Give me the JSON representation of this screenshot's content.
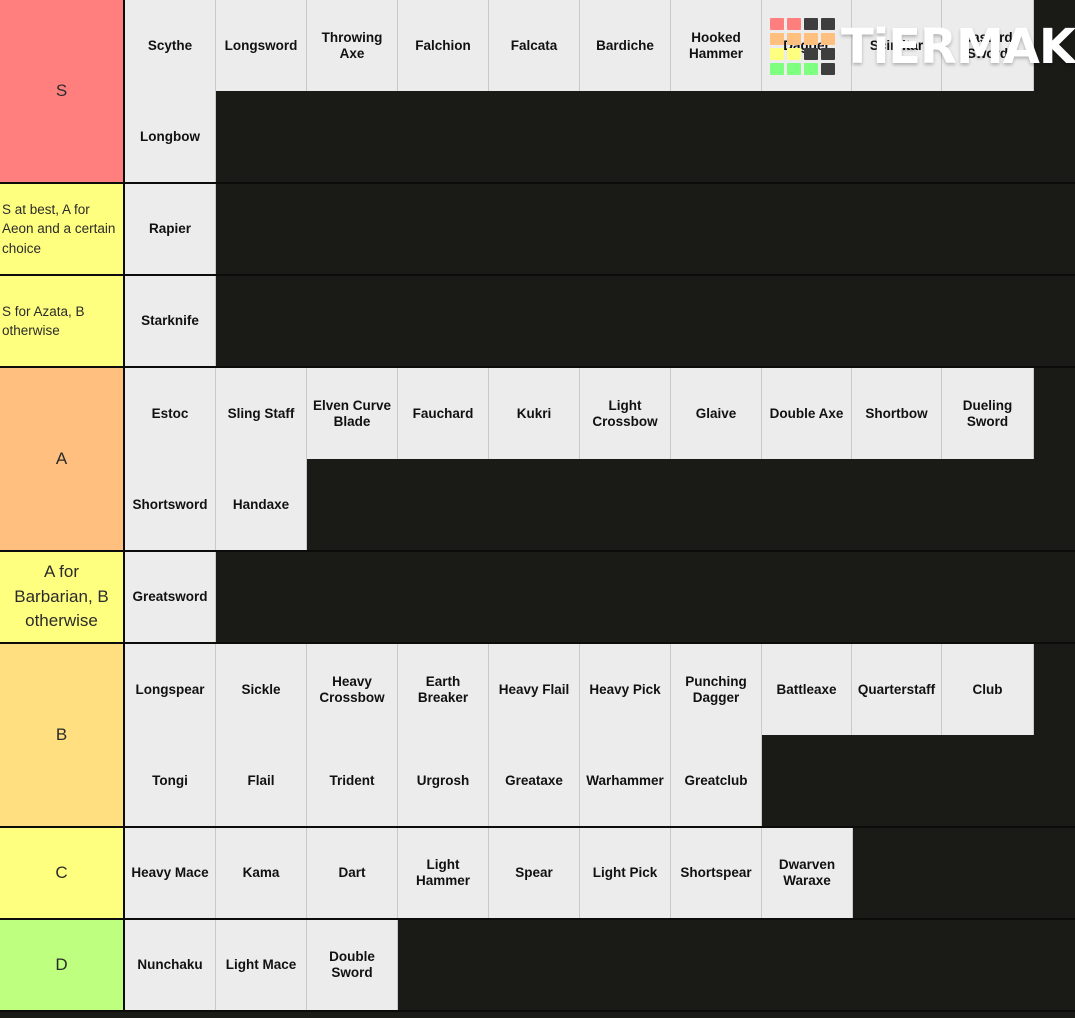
{
  "watermark": {
    "text": "TiERMAKER",
    "grid_colors": [
      "#ff7f7f",
      "#ff7f7f",
      "#3e3e3e",
      "#3e3e3e",
      "#ffbf7f",
      "#ffbf7f",
      "#ffbf7f",
      "#ffbf7f",
      "#ffff7f",
      "#ffff7f",
      "#3e3e3e",
      "#3e3e3e",
      "#7fff7f",
      "#7fff7f",
      "#7fff7f",
      "#3e3e3e"
    ]
  },
  "colors": {
    "tier_s": "#ff7f7f",
    "tier_note_yellow": "#ffff7f",
    "tier_a": "#ffbf7f",
    "tier_b": "#ffdf7f",
    "tier_c": "#ffff7f",
    "tier_d": "#bfff7f",
    "background": "#1a1a17",
    "item_background": "#ececec"
  },
  "tiers": [
    {
      "label": "S",
      "color": "#ff7f7f",
      "label_style": "big",
      "height": 184,
      "lines": [
        {
          "height": 92,
          "items": [
            {
              "text": "Scythe",
              "width": 91
            },
            {
              "text": "Longsword",
              "width": 91
            },
            {
              "text": "Throwing Axe",
              "width": 91
            },
            {
              "text": "Falchion",
              "width": 91
            },
            {
              "text": "Falcata",
              "width": 91
            },
            {
              "text": "Bardiche",
              "width": 91
            },
            {
              "text": "Hooked Hammer",
              "width": 91
            },
            {
              "text": "Dagger",
              "width": 90
            },
            {
              "text": "Scimitar",
              "width": 90
            },
            {
              "text": "Bastard Sword",
              "width": 92
            }
          ]
        },
        {
          "height": 92,
          "items": [
            {
              "text": "Longbow",
              "width": 91
            }
          ]
        }
      ]
    },
    {
      "label": "S at best, A for Aeon and a certain choice",
      "color": "#ffff7f",
      "label_style": "note",
      "height": 92,
      "lines": [
        {
          "height": 92,
          "items": [
            {
              "text": "Rapier",
              "width": 91
            }
          ]
        }
      ]
    },
    {
      "label": "S for Azata, B otherwise",
      "color": "#ffff7f",
      "label_style": "note",
      "height": 92,
      "lines": [
        {
          "height": 92,
          "items": [
            {
              "text": "Starknife",
              "width": 91
            }
          ]
        }
      ]
    },
    {
      "label": "A",
      "color": "#ffbf7f",
      "label_style": "big",
      "height": 184,
      "lines": [
        {
          "height": 92,
          "items": [
            {
              "text": "Estoc",
              "width": 91
            },
            {
              "text": "Sling Staff",
              "width": 91
            },
            {
              "text": "Elven Curve Blade",
              "width": 91
            },
            {
              "text": "Fauchard",
              "width": 91
            },
            {
              "text": "Kukri",
              "width": 91
            },
            {
              "text": "Light Crossbow",
              "width": 91
            },
            {
              "text": "Glaive",
              "width": 91
            },
            {
              "text": "Double Axe",
              "width": 90
            },
            {
              "text": "Shortbow",
              "width": 90
            },
            {
              "text": "Dueling Sword",
              "width": 92
            }
          ]
        },
        {
          "height": 92,
          "items": [
            {
              "text": "Shortsword",
              "width": 91
            },
            {
              "text": "Handaxe",
              "width": 91
            }
          ]
        }
      ]
    },
    {
      "label": "A for Barbarian, B otherwise",
      "color": "#ffff7f",
      "label_style": "big",
      "height": 92,
      "lines": [
        {
          "height": 92,
          "items": [
            {
              "text": "Greatsword",
              "width": 91
            }
          ]
        }
      ]
    },
    {
      "label": "B",
      "color": "#ffdf7f",
      "label_style": "big",
      "height": 184,
      "lines": [
        {
          "height": 92,
          "items": [
            {
              "text": "Longspear",
              "width": 91
            },
            {
              "text": "Sickle",
              "width": 91
            },
            {
              "text": "Heavy Crossbow",
              "width": 91
            },
            {
              "text": "Earth Breaker",
              "width": 91
            },
            {
              "text": "Heavy Flail",
              "width": 91
            },
            {
              "text": "Heavy Pick",
              "width": 91
            },
            {
              "text": "Punching Dagger",
              "width": 91
            },
            {
              "text": "Battleaxe",
              "width": 90
            },
            {
              "text": "Quarterstaff",
              "width": 90
            },
            {
              "text": "Club",
              "width": 92
            }
          ]
        },
        {
          "height": 92,
          "items": [
            {
              "text": "Tongi",
              "width": 91
            },
            {
              "text": "Flail",
              "width": 91
            },
            {
              "text": "Trident",
              "width": 91
            },
            {
              "text": "Urgrosh",
              "width": 91
            },
            {
              "text": "Greataxe",
              "width": 91
            },
            {
              "text": "Warhammer",
              "width": 91
            },
            {
              "text": "Greatclub",
              "width": 91
            }
          ]
        }
      ]
    },
    {
      "label": "C",
      "color": "#ffff7f",
      "label_style": "big",
      "height": 92,
      "lines": [
        {
          "height": 92,
          "items": [
            {
              "text": "Heavy Mace",
              "width": 91
            },
            {
              "text": "Kama",
              "width": 91
            },
            {
              "text": "Dart",
              "width": 91
            },
            {
              "text": "Light Hammer",
              "width": 91
            },
            {
              "text": "Spear",
              "width": 91
            },
            {
              "text": "Light Pick",
              "width": 91
            },
            {
              "text": "Shortspear",
              "width": 91
            },
            {
              "text": "Dwarven Waraxe",
              "width": 91
            }
          ]
        }
      ]
    },
    {
      "label": "D",
      "color": "#bfff7f",
      "label_style": "big",
      "height": 92,
      "lines": [
        {
          "height": 92,
          "items": [
            {
              "text": "Nunchaku",
              "width": 91
            },
            {
              "text": "Light Mace",
              "width": 91
            },
            {
              "text": "Double Sword",
              "width": 91
            }
          ]
        }
      ]
    }
  ]
}
